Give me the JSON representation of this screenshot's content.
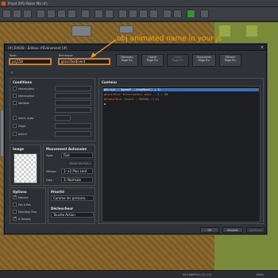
{
  "app": {
    "window_title": "Projet RPG Maker MV (#)"
  },
  "dialog": {
    "title": "[#] EV028 - Éditeur d'Évènement [#]",
    "close_glyph": "✕",
    "name_label": "Nom:",
    "name_value": "pnj158",
    "note_label": "Remarque:",
    "note_value": "grassTextEvent",
    "buttons": {
      "new_page": "Nouveau\nPage Év.",
      "copy_page": "Copier\nPage Év.",
      "paste_page": "Coller\nPage Év.",
      "delete_page": "Supprimer\nPage Év.",
      "clear_page": "Effacer\nPage Év."
    },
    "conditions": {
      "header": "Conditions",
      "switch1": "Interrupteur",
      "switch2": "Interrupteur",
      "variable": "Variable",
      "self_switch": "Interr. Auto.",
      "item": "Objet",
      "actor": "Acteur"
    },
    "image": {
      "header": "Image"
    },
    "movement": {
      "header": "Mouvement Autonome",
      "type_label": "Type:",
      "type_value": "Fixe",
      "route_button": "Route de mvt...",
      "speed_label": "Vitesse:",
      "speed_value": "3: x2 Plus Lent",
      "freq_label": "Fréq.:",
      "freq_value": "3: Normale"
    },
    "options": {
      "header": "Options",
      "walking": "Marche",
      "stepping": "Pas à Pas",
      "direction_fix": "Direction Fixe",
      "through": "À Travers"
    },
    "priority": {
      "header": "Priorité",
      "value": "Comme les persona..."
    },
    "trigger": {
      "header": "Déclencheur",
      "value": "Touche Action"
    },
    "content": {
      "header": "Contenu",
      "lines": [
        "◆Script : $gameP...stepMove() + 1)",
        "◆Contrôler Interrupteur Auto. : A = ON",
        "◆Transférer Joueur : MAP001 (7,8)",
        "◆"
      ]
    },
    "footer": {
      "ok": "OK",
      "cancel": "Annuler",
      "apply": "Appliquer"
    }
  },
  "annotation": {
    "text": "obj animated name in your js"
  },
  "status": {
    "map": "001:MAP001 (11,11)",
    "zoom": "100%"
  },
  "colors": {
    "accent": "#d0842a",
    "selection": "#3b6fb4",
    "command_orange": "#e07a3a"
  }
}
